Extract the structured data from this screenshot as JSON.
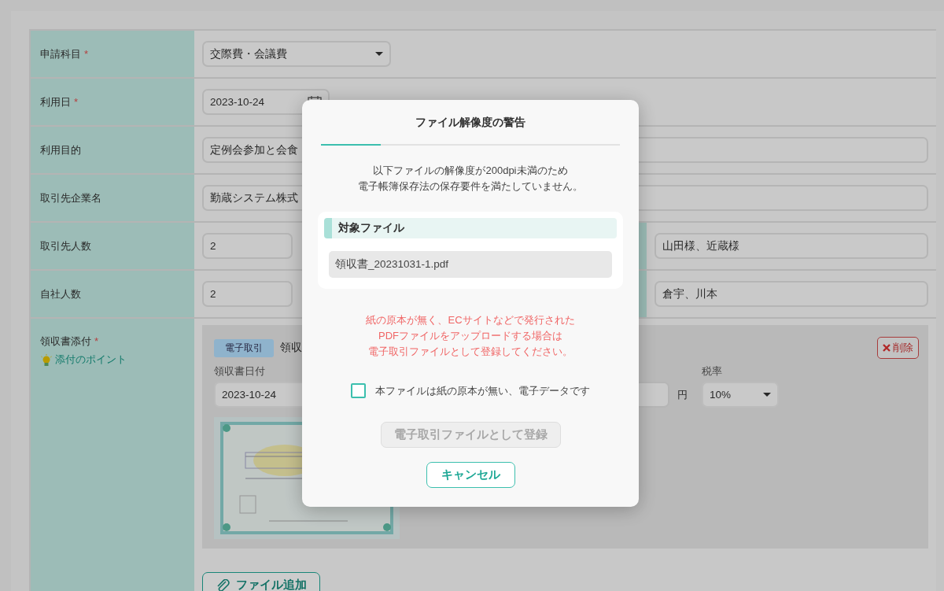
{
  "form": {
    "rows": [
      {
        "kind": "select",
        "label": "申請科目",
        "required_mark": "*",
        "value": "交際費・会議費"
      },
      {
        "kind": "date",
        "label": "利用日",
        "required_mark": "*",
        "value": "2023-10-24"
      },
      {
        "kind": "text",
        "label": "利用目的",
        "value": "定例会参加と会食"
      },
      {
        "kind": "text",
        "label": "取引先企業名",
        "value": "勤蔵システム株式"
      },
      {
        "kind": "count",
        "label": "取引先人数",
        "value": "2",
        "names": "山田様、近蔵様"
      },
      {
        "kind": "count",
        "label": "自社人数",
        "value": "2",
        "names": "倉宇、川本"
      },
      {
        "kind": "attachment",
        "label": "領収書添付",
        "required_mark": "*",
        "hint": "添付のポイント"
      }
    ]
  },
  "attachment": {
    "tag": "電子取引",
    "title": "領収",
    "delete": "削除",
    "date_label": "領収書日付",
    "date": "2023-10-24",
    "currency": "円",
    "tax_label": "税率",
    "tax": "10%",
    "add_file": "ファイル追加"
  },
  "dialog": {
    "title": "ファイル解像度の警告",
    "progress": {
      "level": 0.2
    },
    "message": [
      "以下ファイルの解像度が200dpi未満のため",
      "電子帳簿保存法の保存要件を満たしていません。"
    ],
    "section_title": "対象ファイル",
    "files": [
      "領収書_20231031-1.pdf"
    ],
    "notice": [
      "紙の原本が無く、ECサイトなどで発行された",
      "PDFファイルをアップロードする場合は",
      "電子取引ファイルとして登録してください。"
    ],
    "checkbox": {
      "label": "本ファイルは紙の原本が無い、電子データです",
      "checked": false
    },
    "buttons": [
      {
        "kind": "primary",
        "label": "電子取引ファイルとして登録",
        "disabled": true
      },
      {
        "kind": "secondary",
        "label": "キャンセル",
        "disabled": false
      }
    ]
  }
}
